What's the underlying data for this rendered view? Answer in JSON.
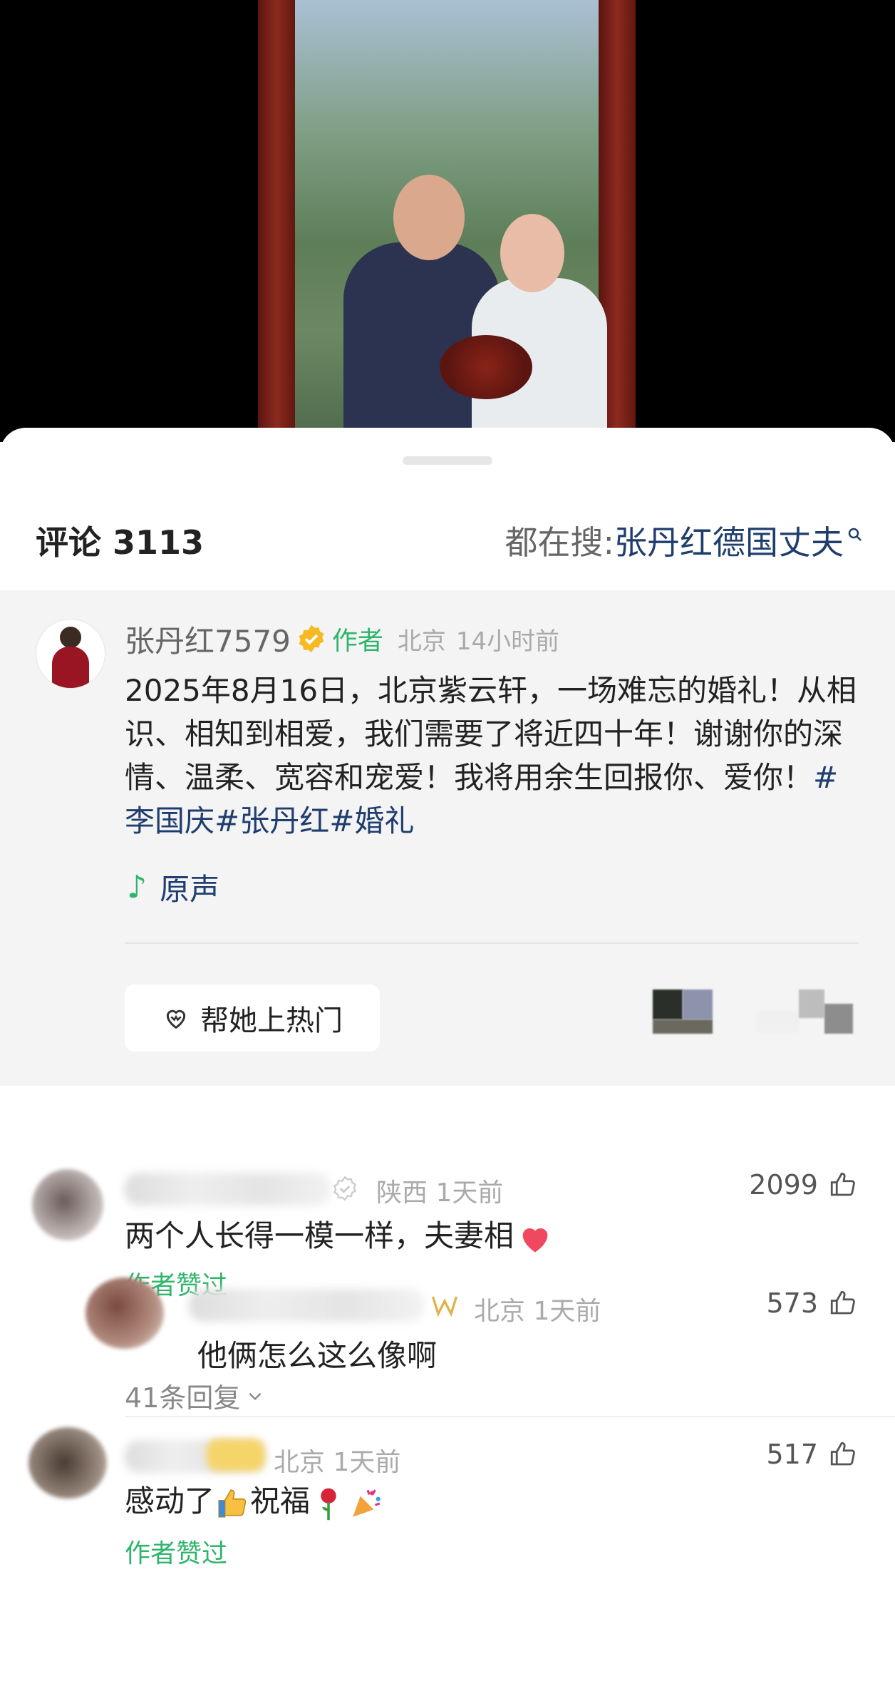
{
  "header": {
    "comments_label": "评论 3113",
    "search_prefix": "都在搜: ",
    "search_keyword": "张丹红德国丈夫"
  },
  "pinned": {
    "username": "张丹红7579",
    "author_tag": "作者",
    "location": "北京",
    "time": "14小时前",
    "text": "2025年8月16日，北京紫云轩，一场难忘的婚礼！从相识、相知到相爱，我们需要了将近四十年！谢谢你的深情、温柔、宽容和宠爱！我将用余生回报你、爱你！",
    "hashtags": "#李国庆#张丹红#婚礼",
    "music_label": "原声",
    "boost_label": "帮她上热门"
  },
  "comments": [
    {
      "meta": "陕西 1天前",
      "text": "两个人长得一模一样，夫妻相",
      "likes": "2099",
      "author_liked": "作者赞过",
      "reply": {
        "meta": "北京 1天前",
        "text": "他俩怎么这么像啊",
        "likes": "573"
      },
      "replies_label": "41条回复"
    },
    {
      "meta": "北京 1天前",
      "text_part1": "感动了",
      "text_part2": "祝福",
      "likes": "517",
      "author_liked": "作者赞过"
    }
  ],
  "colors": {
    "accent_green": "#2fb56b",
    "link_blue": "#1f3e6e",
    "meta_gray": "#aaaaaa"
  }
}
